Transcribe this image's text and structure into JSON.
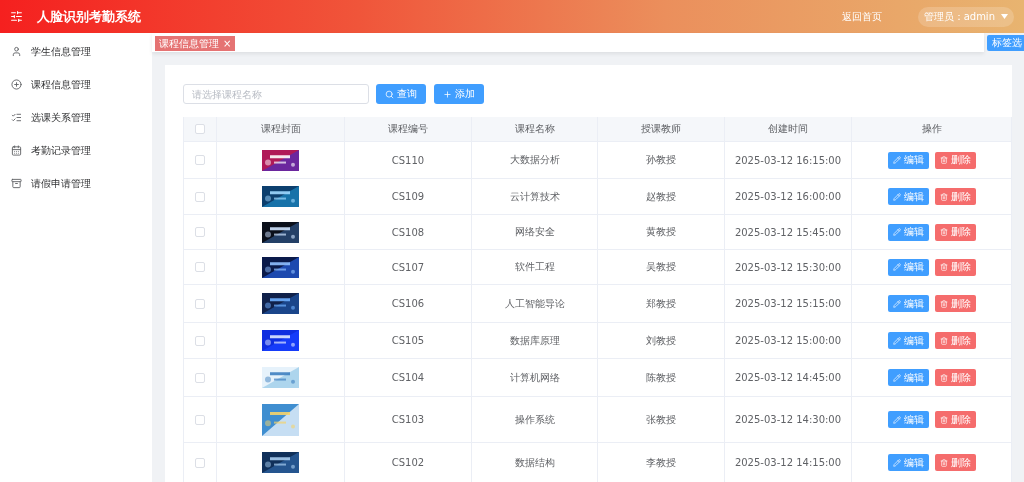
{
  "header": {
    "title": "人脸识别考勤系统",
    "home_link": "返回首页",
    "user": "管理员：admin"
  },
  "sidebar": {
    "items": [
      {
        "label": "学生信息管理",
        "selected": false
      },
      {
        "label": "课程信息管理",
        "selected": false
      },
      {
        "label": "选课关系管理",
        "selected": false
      },
      {
        "label": "考勤记录管理",
        "selected": false
      },
      {
        "label": "请假申请管理",
        "selected": false
      }
    ]
  },
  "tags": {
    "items": [
      {
        "label": "课程信息管理",
        "close": "×",
        "selected": true
      }
    ],
    "options_button": "标签选"
  },
  "toolbar": {
    "search": {
      "placeholder": "请选择课程名称"
    },
    "query_button": "查询",
    "add_button": "添加"
  },
  "table": {
    "select_all": {
      "checked": false
    },
    "columns": [
      "课程封面",
      "课程编号",
      "课程名称",
      "授课教师",
      "创建时间",
      "操作"
    ],
    "rows": [
      {
        "checked": false,
        "code": "CS110",
        "name": "大数据分析",
        "teacher": "孙教授",
        "created": "2025-03-12 16:15:00",
        "edit": "编辑",
        "delete": "删除"
      },
      {
        "checked": false,
        "code": "CS109",
        "name": "云计算技术",
        "teacher": "赵教授",
        "created": "2025-03-12 16:00:00",
        "edit": "编辑",
        "delete": "删除"
      },
      {
        "checked": false,
        "code": "CS108",
        "name": "网络安全",
        "teacher": "黄教授",
        "created": "2025-03-12 15:45:00",
        "edit": "编辑",
        "delete": "删除"
      },
      {
        "checked": false,
        "code": "CS107",
        "name": "软件工程",
        "teacher": "吴教授",
        "created": "2025-03-12 15:30:00",
        "edit": "编辑",
        "delete": "删除"
      },
      {
        "checked": false,
        "code": "CS106",
        "name": "人工智能导论",
        "teacher": "郑教授",
        "created": "2025-03-12 15:15:00",
        "edit": "编辑",
        "delete": "删除"
      },
      {
        "checked": false,
        "code": "CS105",
        "name": "数据库原理",
        "teacher": "刘教授",
        "created": "2025-03-12 15:00:00",
        "edit": "编辑",
        "delete": "删除"
      },
      {
        "checked": false,
        "code": "CS104",
        "name": "计算机网络",
        "teacher": "陈教授",
        "created": "2025-03-12 14:45:00",
        "edit": "编辑",
        "delete": "删除"
      },
      {
        "checked": false,
        "code": "CS103",
        "name": "操作系统",
        "teacher": "张教授",
        "created": "2025-03-12 14:30:00",
        "edit": "编辑",
        "delete": "删除"
      },
      {
        "checked": false,
        "code": "CS102",
        "name": "数据结构",
        "teacher": "李教授",
        "created": "2025-03-12 14:15:00",
        "edit": "编辑",
        "delete": "删除"
      }
    ]
  }
}
